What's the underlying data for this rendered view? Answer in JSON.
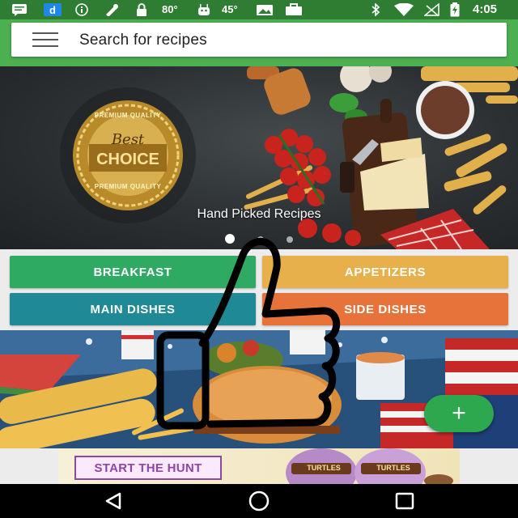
{
  "status_bar": {
    "battery_temp": "80°",
    "cpu_temp": "45°",
    "time": "4:05"
  },
  "search": {
    "placeholder": "Search for recipes"
  },
  "hero": {
    "caption": "Hand Picked Recipes",
    "badge": {
      "top": "PREMIUM QUALITY",
      "line1": "Best",
      "line2": "CHOICE",
      "bottom": "PREMIUM QUALITY"
    },
    "active_slide": 1,
    "slide_count": 3
  },
  "categories": [
    {
      "label": "BREAKFAST",
      "color": "#2eaa63"
    },
    {
      "label": "APPETIZERS",
      "color": "#e8b04a"
    },
    {
      "label": "MAIN DISHES",
      "color": "#1f8a96"
    },
    {
      "label": "SIDE DISHES",
      "color": "#e8733a"
    }
  ],
  "fab": {
    "symbol": "+"
  },
  "ad": {
    "cta": "START THE HUNT",
    "brand": "TURTLES"
  },
  "colors": {
    "status_bar": "#2e7d32",
    "app_bar": "#4caf50",
    "fab": "#2ea84f"
  }
}
